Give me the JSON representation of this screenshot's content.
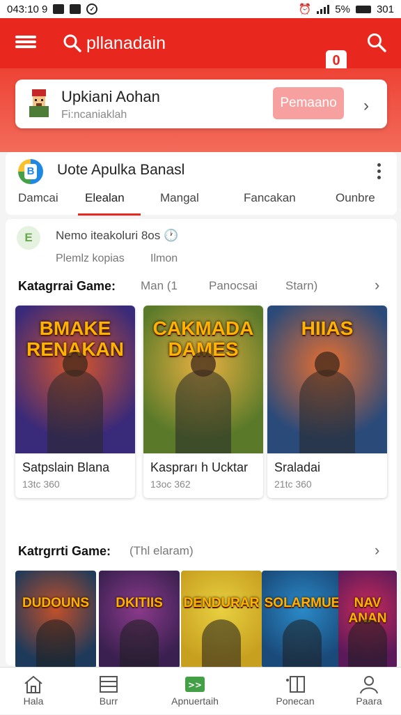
{
  "status_bar": {
    "time": "043:10 9",
    "right_text": "5%",
    "clock": "301",
    "icons": [
      "bell-icon",
      "image-icon",
      "whatsapp-icon",
      "alarm-icon",
      "signal-icon",
      "battery-icon"
    ]
  },
  "header": {
    "title": "pllanadain",
    "badge": "0",
    "icons": [
      "menu-icon",
      "search-icon",
      "search-icon"
    ]
  },
  "promo": {
    "title": "Upkiani Aohan",
    "subtitle": "Fi:ncaniaklah",
    "button": "Pemaano",
    "chevron": "›"
  },
  "app_card": {
    "name": "Uote Apulka Banasl",
    "logo_letter": "B",
    "tabs": [
      {
        "label": "Damcai"
      },
      {
        "label": "Elealan"
      },
      {
        "label": "Mangal"
      },
      {
        "label": "Fancakan"
      },
      {
        "label": "Ounbre"
      }
    ]
  },
  "profile": {
    "avatar_letter": "E",
    "name": "Nemo iteakoluri 8os 🕐",
    "sub1": "Plemlz kopias",
    "sub2": "Ilmon"
  },
  "section1": {
    "title": "Katagrrai Game:",
    "filters": [
      "Man (1",
      "Panocsai",
      "Starn)"
    ],
    "arrow": "›"
  },
  "games": [
    {
      "title": "Satpslain Blana",
      "sub": "13tc 360",
      "art": "BMAKE RENAKAN",
      "color": "#3a2a7a"
    },
    {
      "title": "Kasprarı h Ucktar",
      "sub": "13oc 362",
      "art": "CAKMADA DAMES",
      "color": "#5a7a2a"
    },
    {
      "title": "Sraladai",
      "sub": "21tc 360",
      "art": "HIIAS",
      "color": "#2a4a7a"
    }
  ],
  "section2": {
    "title": "Katrgrrti Game:",
    "filter": "(Thl elaram)",
    "arrow": "›"
  },
  "thumbs": [
    {
      "art": "DUDOUNS",
      "color": "#1e3a5a"
    },
    {
      "art": "DKITIIS",
      "color": "#3a2050"
    },
    {
      "art": "DENDURAR",
      "color": "#c8a020"
    },
    {
      "art": "SOLARMUE",
      "color": "#1a4a7a"
    },
    {
      "art": "NAV ANAN",
      "color": "#5a1a5a"
    }
  ],
  "bottom_nav": [
    {
      "label": "Hala",
      "icon": "home-icon"
    },
    {
      "label": "Burr",
      "icon": "list-icon"
    },
    {
      "label": "Apnuertaih",
      "icon": "games-icon"
    },
    {
      "label": "Ponecan",
      "icon": "book-icon"
    },
    {
      "label": "Paara",
      "icon": "profile-icon"
    }
  ],
  "colors": {
    "primary": "#e8271f",
    "promo_button": "#f6a0a0"
  }
}
